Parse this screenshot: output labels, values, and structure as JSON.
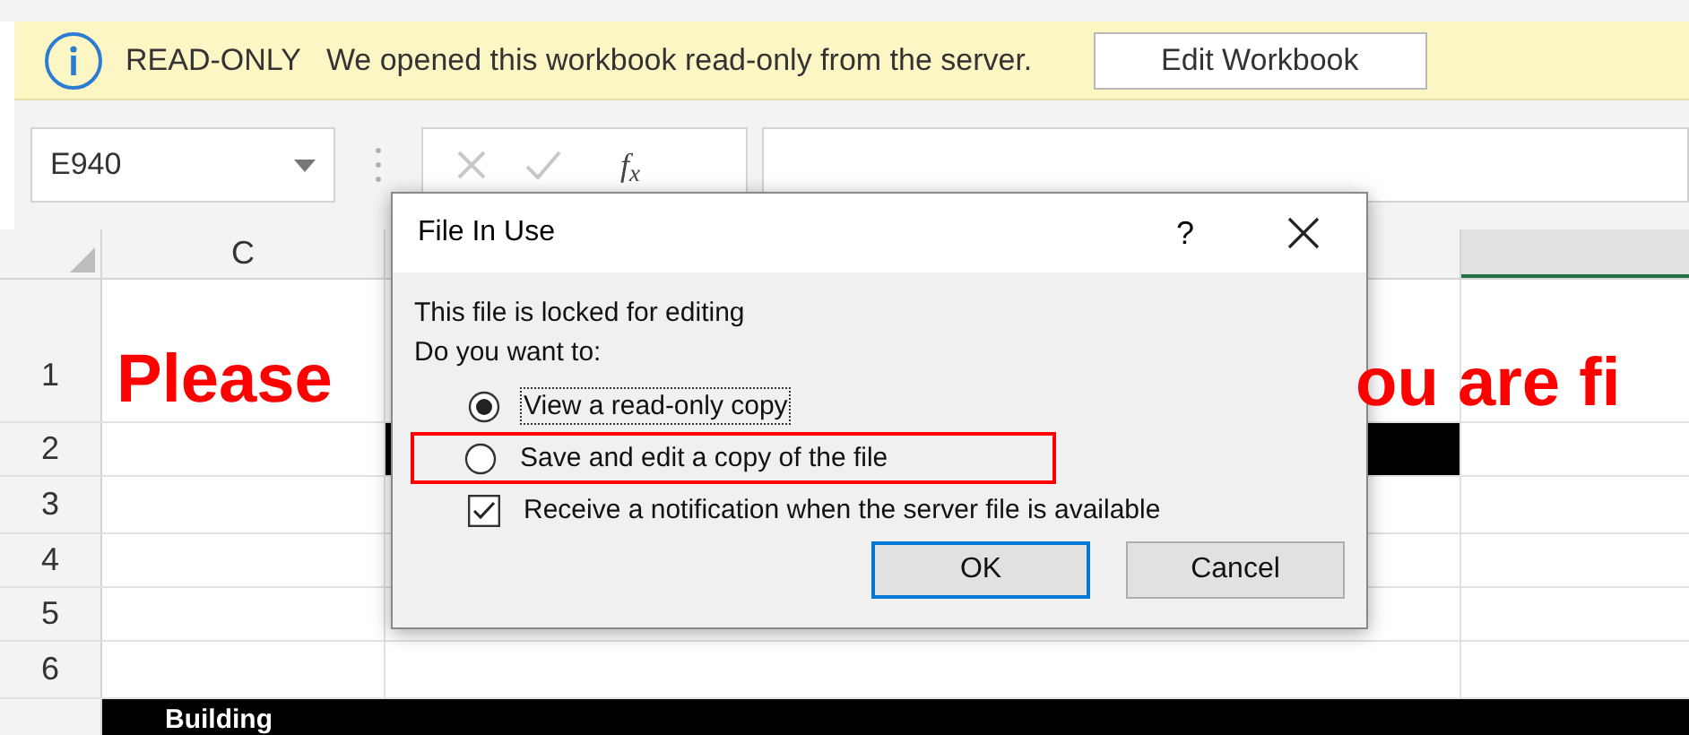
{
  "message_bar": {
    "label": "READ-ONLY",
    "message": "We opened this workbook read-only from the server.",
    "button": "Edit Workbook"
  },
  "formula_bar": {
    "name_box": "E940",
    "function_symbol": "f$_{x}$"
  },
  "sheet": {
    "columns": [
      {
        "label": "C"
      }
    ],
    "rows": [
      {
        "header": "1"
      },
      {
        "header": "2"
      },
      {
        "header": "3"
      },
      {
        "header": "4"
      },
      {
        "header": "5"
      },
      {
        "header": "6"
      }
    ],
    "title_fragments": [
      "Please",
      "ou are fi"
    ],
    "section_label": "Building"
  },
  "dialog": {
    "title": "File In Use",
    "help": "?",
    "message": "This file is locked for editing",
    "prompt": "Do you want to:",
    "options": [
      {
        "kind": "radio",
        "label": "View a read-only copy",
        "selected": true,
        "focused": true,
        "highlighted": false
      },
      {
        "kind": "radio",
        "label": "Save and edit a copy of the file",
        "selected": false,
        "focused": false,
        "highlighted": true
      },
      {
        "kind": "checkbox",
        "label": "Receive a notification when the server file is available",
        "checked": true,
        "focused": false,
        "highlighted": false
      }
    ],
    "buttons": [
      {
        "label": "OK",
        "default": true
      },
      {
        "label": "Cancel",
        "default": false
      }
    ]
  }
}
